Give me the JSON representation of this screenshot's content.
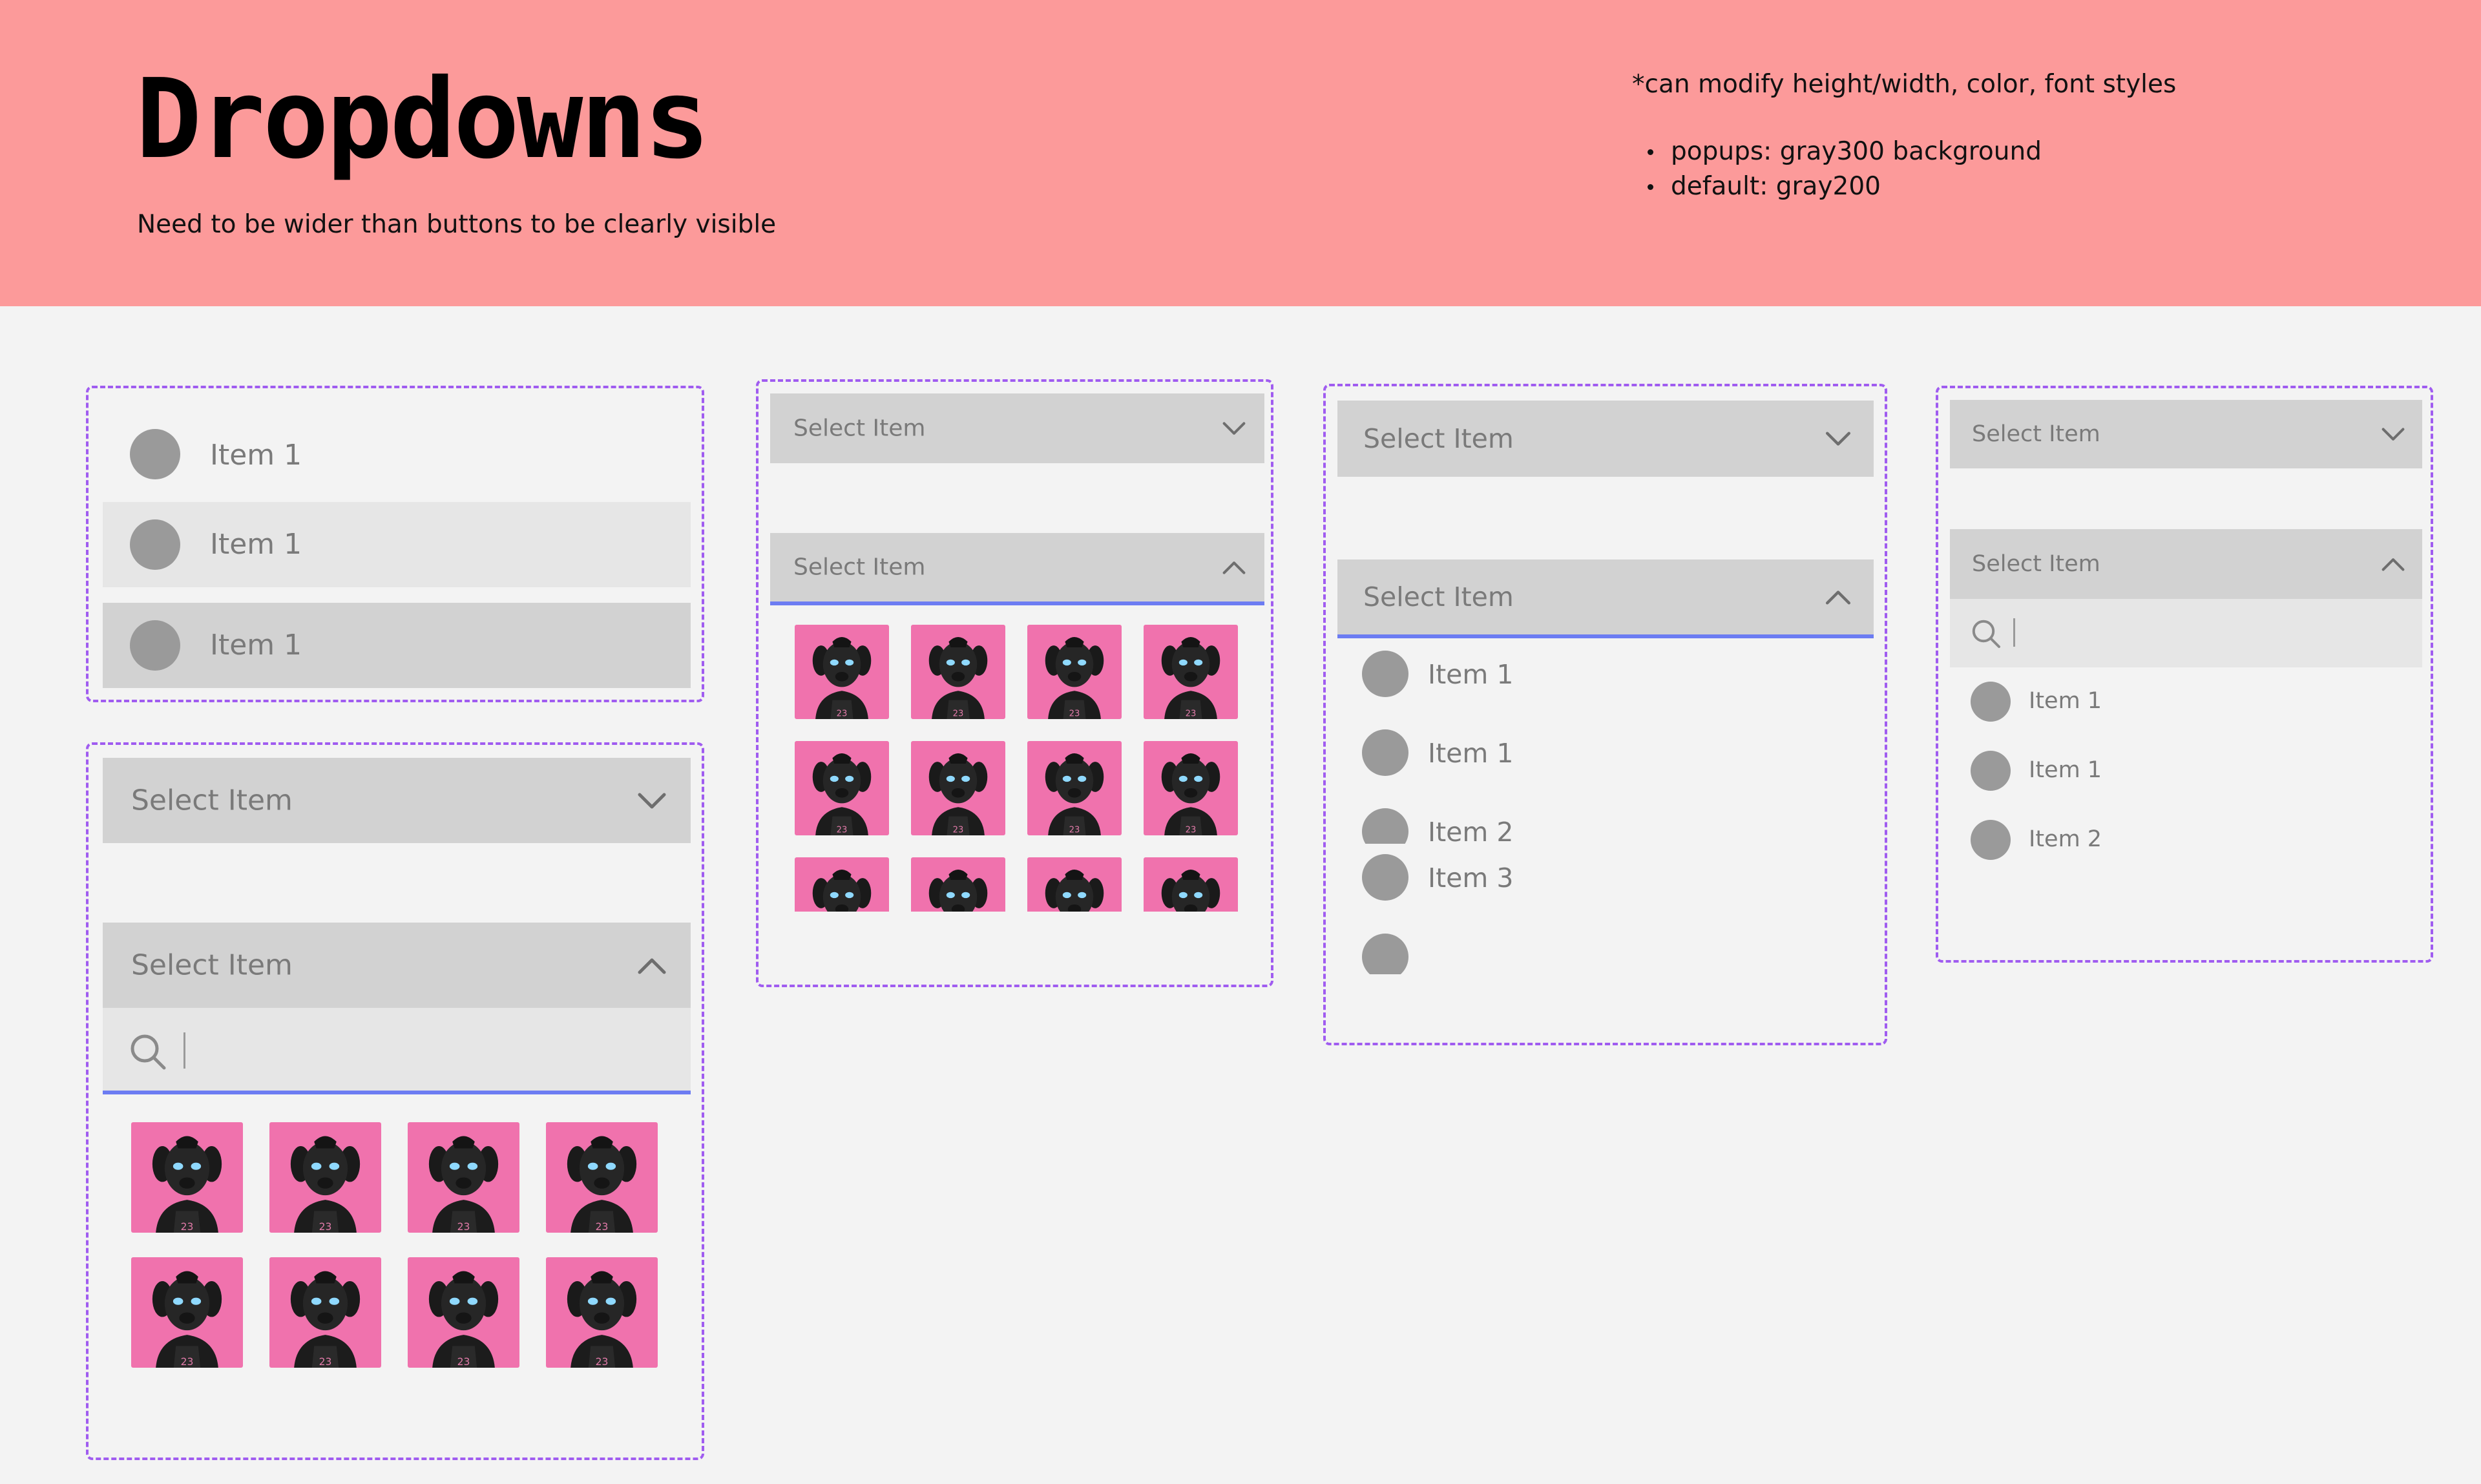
{
  "header": {
    "title": "Dropdowns",
    "subtitle": "Need to be wider than buttons to be clearly visible",
    "note": "*can modify height/width, color, font styles",
    "bullets": [
      "popups: gray300 background",
      "default: gray200"
    ]
  },
  "colors": {
    "header_bg": "#fc9a9a",
    "page_bg": "#f3f3f3",
    "frame_border": "#a05cf0",
    "field_bg": "#d2d2d2",
    "search_bg": "#e6e6e6",
    "hover_bg": "#e6e6e6",
    "active_underline": "#6c7cf2",
    "thumb_bg": "#f072ad"
  },
  "list_items_demo": {
    "items": [
      "Item 1",
      "Item 1",
      "Item 1"
    ]
  },
  "search_grid_dropdown": {
    "closed_label": "Select Item",
    "open_label": "Select Item",
    "search_value": ""
  },
  "grid_dropdown": {
    "closed_label": "Select Item",
    "open_label": "Select Item"
  },
  "list_dropdown": {
    "closed_label": "Select Item",
    "open_label": "Select Item",
    "items": [
      "Item 1",
      "Item 1",
      "Item 2",
      "Item 3"
    ]
  },
  "search_list_dropdown": {
    "closed_label": "Select Item",
    "open_label": "Select Item",
    "search_value": "",
    "items": [
      "Item 1",
      "Item 1",
      "Item 2"
    ]
  },
  "icons": {
    "chevron_down": "chevron-down-icon",
    "chevron_up": "chevron-up-icon",
    "search": "search-icon",
    "avatar": "avatar-thumbnail"
  }
}
